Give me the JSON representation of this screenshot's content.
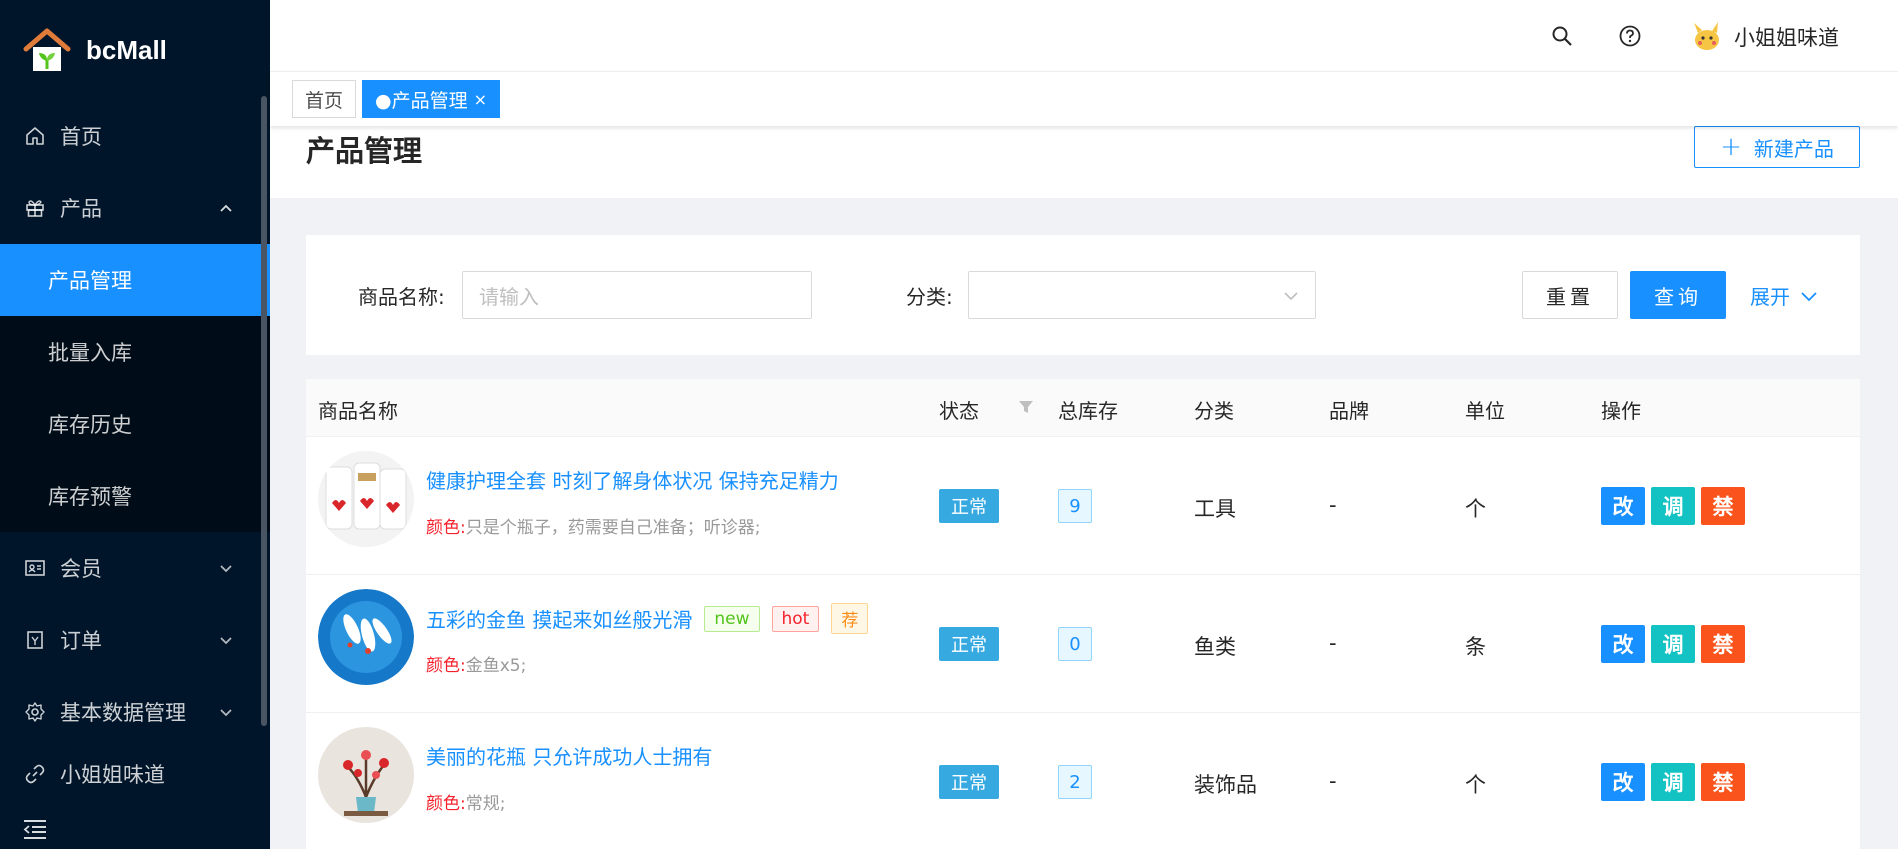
{
  "app": {
    "name": "bcMall"
  },
  "sidebar": {
    "items": [
      {
        "label": "首页",
        "icon": "home-icon"
      },
      {
        "label": "产品",
        "icon": "gift-icon",
        "expanded": true,
        "children": [
          {
            "label": "产品管理",
            "active": true
          },
          {
            "label": "批量入库"
          },
          {
            "label": "库存历史"
          },
          {
            "label": "库存预警"
          }
        ]
      },
      {
        "label": "会员",
        "icon": "idcard-icon"
      },
      {
        "label": "订单",
        "icon": "order-icon"
      },
      {
        "label": "基本数据管理",
        "icon": "setting-icon"
      },
      {
        "label": "小姐姐味道",
        "icon": "link-icon"
      }
    ]
  },
  "header": {
    "username": "小姐姐味道"
  },
  "tabs": [
    {
      "label": "首页"
    },
    {
      "label": "●产品管理",
      "close": "×",
      "active": true
    }
  ],
  "page": {
    "title": "产品管理",
    "new_button": "新建产品",
    "new_button_icon": "+"
  },
  "search": {
    "name_label": "商品名称:",
    "name_placeholder": "请输入",
    "category_label": "分类:",
    "reset": "重置",
    "query": "查询",
    "expand": "展开"
  },
  "table": {
    "columns": [
      "商品名称",
      "状态",
      "总库存",
      "分类",
      "品牌",
      "单位",
      "操作"
    ],
    "color_key": "颜色:",
    "rows": [
      {
        "name": "健康护理全套 时刻了解身体状况 保持充足精力",
        "color": "只是个瓶子，药需要自己准备；听诊器;",
        "status": "正常",
        "stock": "9",
        "category": "工具",
        "brand": "-",
        "unit": "个",
        "tags": []
      },
      {
        "name": "五彩的金鱼 摸起来如丝般光滑",
        "color": "金鱼x5;",
        "status": "正常",
        "stock": "0",
        "category": "鱼类",
        "brand": "-",
        "unit": "条",
        "tags": [
          "new",
          "hot",
          "荐"
        ]
      },
      {
        "name": "美丽的花瓶 只允许成功人士拥有",
        "color": "常规;",
        "status": "正常",
        "stock": "2",
        "category": "装饰品",
        "brand": "-",
        "unit": "个",
        "tags": []
      }
    ],
    "actions": {
      "edit": "改",
      "adjust": "调",
      "ban": "禁"
    }
  }
}
